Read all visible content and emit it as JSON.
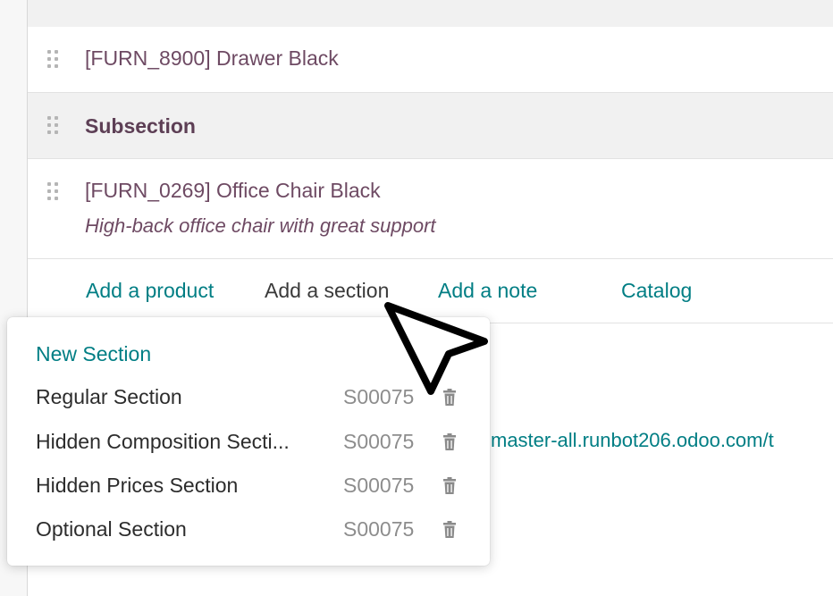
{
  "lines": {
    "product1": {
      "label": "[FURN_8900] Drawer Black"
    },
    "subsection": {
      "label": "Subsection"
    },
    "product2": {
      "label": "[FURN_0269] Office Chair Black",
      "description": "High-back office chair with great support"
    }
  },
  "actions": {
    "add_product": "Add a product",
    "add_section": "Add a section",
    "add_note": "Add a note",
    "catalog": "Catalog"
  },
  "background_link": "master-all.runbot206.odoo.com/t",
  "dropdown": {
    "new_section": "New Section",
    "items": [
      {
        "name": "Regular Section",
        "ref": "S00075",
        "icon": "trash-icon"
      },
      {
        "name": "Hidden Composition Secti...",
        "ref": "S00075",
        "icon": "trash-icon"
      },
      {
        "name": "Hidden Prices Section",
        "ref": "S00075",
        "icon": "trash-icon"
      },
      {
        "name": "Optional Section",
        "ref": "S00075",
        "icon": "trash-icon"
      }
    ]
  },
  "colors": {
    "accent": "#017e84",
    "line_text": "#6e4a63"
  }
}
